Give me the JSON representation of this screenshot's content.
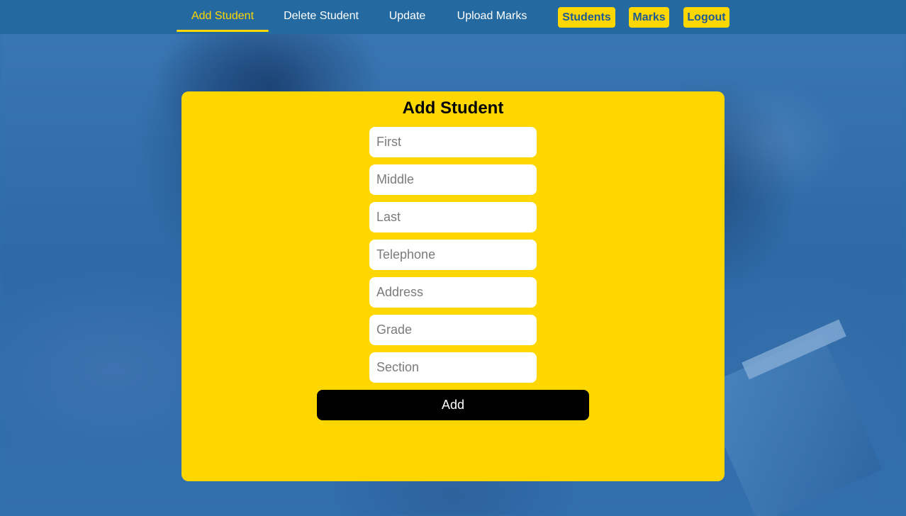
{
  "nav": {
    "links": [
      {
        "label": "Add Student",
        "active": true
      },
      {
        "label": "Delete Student",
        "active": false
      },
      {
        "label": "Update",
        "active": false
      },
      {
        "label": "Upload Marks",
        "active": false
      }
    ],
    "buttons": [
      {
        "label": "Students"
      },
      {
        "label": "Marks"
      },
      {
        "label": "Logout"
      }
    ]
  },
  "form": {
    "title": "Add Student",
    "fields": [
      {
        "placeholder": "First",
        "value": ""
      },
      {
        "placeholder": "Middle",
        "value": ""
      },
      {
        "placeholder": "Last",
        "value": ""
      },
      {
        "placeholder": "Telephone",
        "value": ""
      },
      {
        "placeholder": "Address",
        "value": ""
      },
      {
        "placeholder": "Grade",
        "value": ""
      },
      {
        "placeholder": "Section",
        "value": ""
      }
    ],
    "submit_label": "Add"
  },
  "colors": {
    "accent": "#ffd700",
    "navbar": "#246aa0",
    "button": "#000000"
  }
}
